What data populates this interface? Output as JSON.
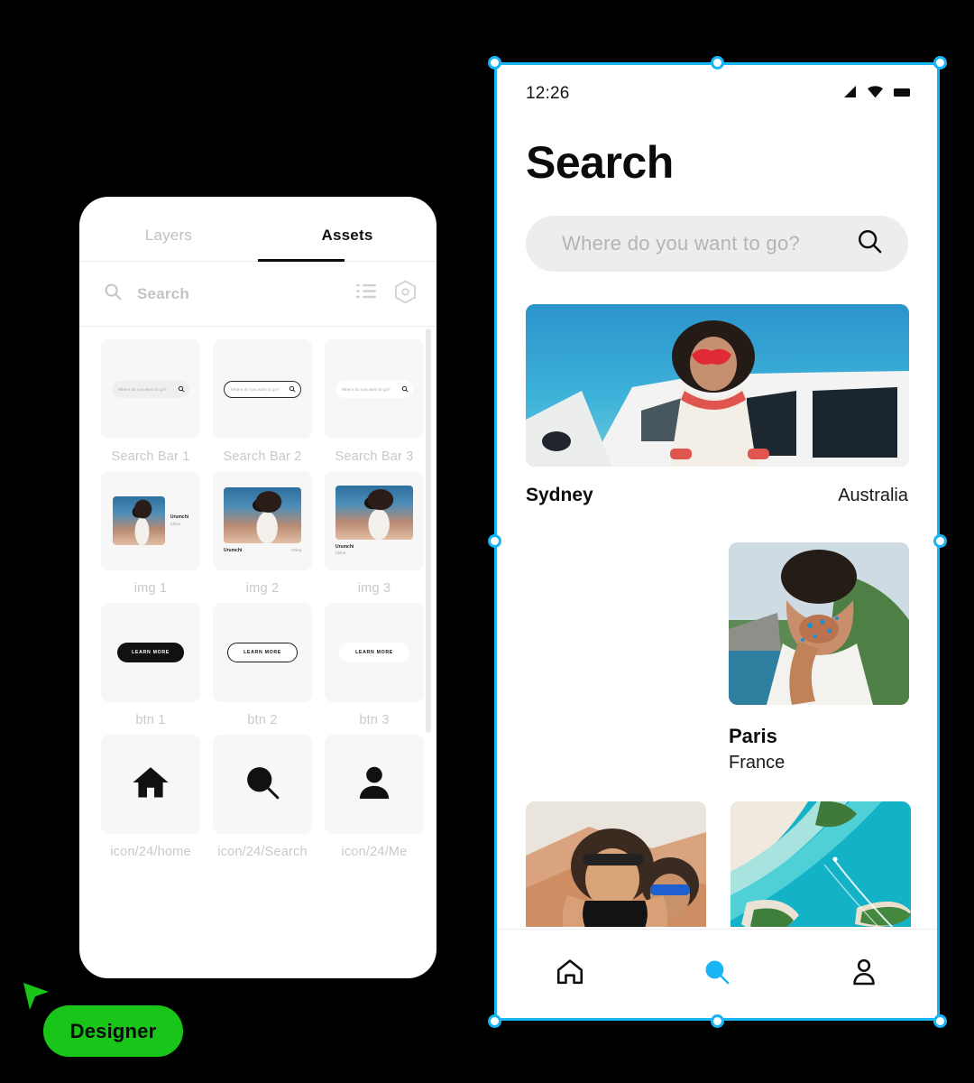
{
  "canvas": {
    "background": "#000000"
  },
  "accents": {
    "selection": "#18b4f5",
    "designer_green": "#19c519",
    "nav_active": "#18b4f5",
    "panel_bg": "#ffffff",
    "thumb_bg": "#f7f7f7"
  },
  "assets_panel": {
    "tabs": [
      {
        "label": "Layers",
        "active": false
      },
      {
        "label": "Assets",
        "active": true
      }
    ],
    "search": {
      "placeholder": "Search",
      "icon": "search-icon"
    },
    "toolbar_icons": [
      {
        "name": "list-view-icon"
      },
      {
        "name": "component-hexagon-icon"
      }
    ],
    "rows": [
      {
        "kind": "search-bars",
        "items": [
          {
            "label": "Search Bar 1",
            "placeholder": "Where do you want to go?",
            "variant": "filled"
          },
          {
            "label": "Search Bar 2",
            "placeholder": "Where do you want to go?",
            "variant": "outlined"
          },
          {
            "label": "Search Bar 3",
            "placeholder": "Where do you want to go?",
            "variant": "plain"
          }
        ]
      },
      {
        "kind": "image-cards",
        "items": [
          {
            "label": "img 1",
            "title": "Urumchi",
            "subtitle": "China",
            "variant": "side"
          },
          {
            "label": "img 2",
            "title": "Urumchi",
            "subtitle": "China",
            "variant": "split"
          },
          {
            "label": "img 3",
            "title": "Urumchi",
            "subtitle": "China",
            "variant": "stacked"
          }
        ]
      },
      {
        "kind": "buttons",
        "items": [
          {
            "label": "btn 1",
            "text": "LEARN MORE",
            "variant": "solid"
          },
          {
            "label": "btn 2",
            "text": "LEARN MORE",
            "variant": "outline"
          },
          {
            "label": "btn 3",
            "text": "LEARN MORE",
            "variant": "ghost"
          }
        ]
      },
      {
        "kind": "icons",
        "items": [
          {
            "label": "icon/24/home",
            "icon": "home-icon"
          },
          {
            "label": "icon/24/Search",
            "icon": "search-icon"
          },
          {
            "label": "icon/24/Me",
            "icon": "person-icon"
          }
        ]
      }
    ]
  },
  "cursor_badge": {
    "label": "Designer",
    "cursor_icon": "pointer-cursor-icon"
  },
  "phone": {
    "status_bar": {
      "time": "12:26",
      "icons": [
        "signal-icon",
        "wifi-icon",
        "battery-icon"
      ]
    },
    "title": "Search",
    "search": {
      "placeholder": "Where do you want to go?",
      "value": "",
      "icon": "search-icon"
    },
    "destinations": [
      {
        "city": "Sydney",
        "country": "Australia",
        "layout": "wide",
        "image": "woman-red-sunglasses-car-photo"
      },
      {
        "city": "Paris",
        "country": "France",
        "layout": "card",
        "image": "man-blowing-kiss-coast-photo"
      },
      {
        "city": "",
        "country": "",
        "layout": "tile",
        "image": "man-taking-phone-photo-desert-photo"
      },
      {
        "city": "",
        "country": "",
        "layout": "tile",
        "image": "aerial-turquoise-lagoon-photo"
      }
    ],
    "bottom_nav": [
      {
        "icon": "home-icon",
        "active": false
      },
      {
        "icon": "search-icon",
        "active": true
      },
      {
        "icon": "person-icon",
        "active": false
      }
    ]
  }
}
